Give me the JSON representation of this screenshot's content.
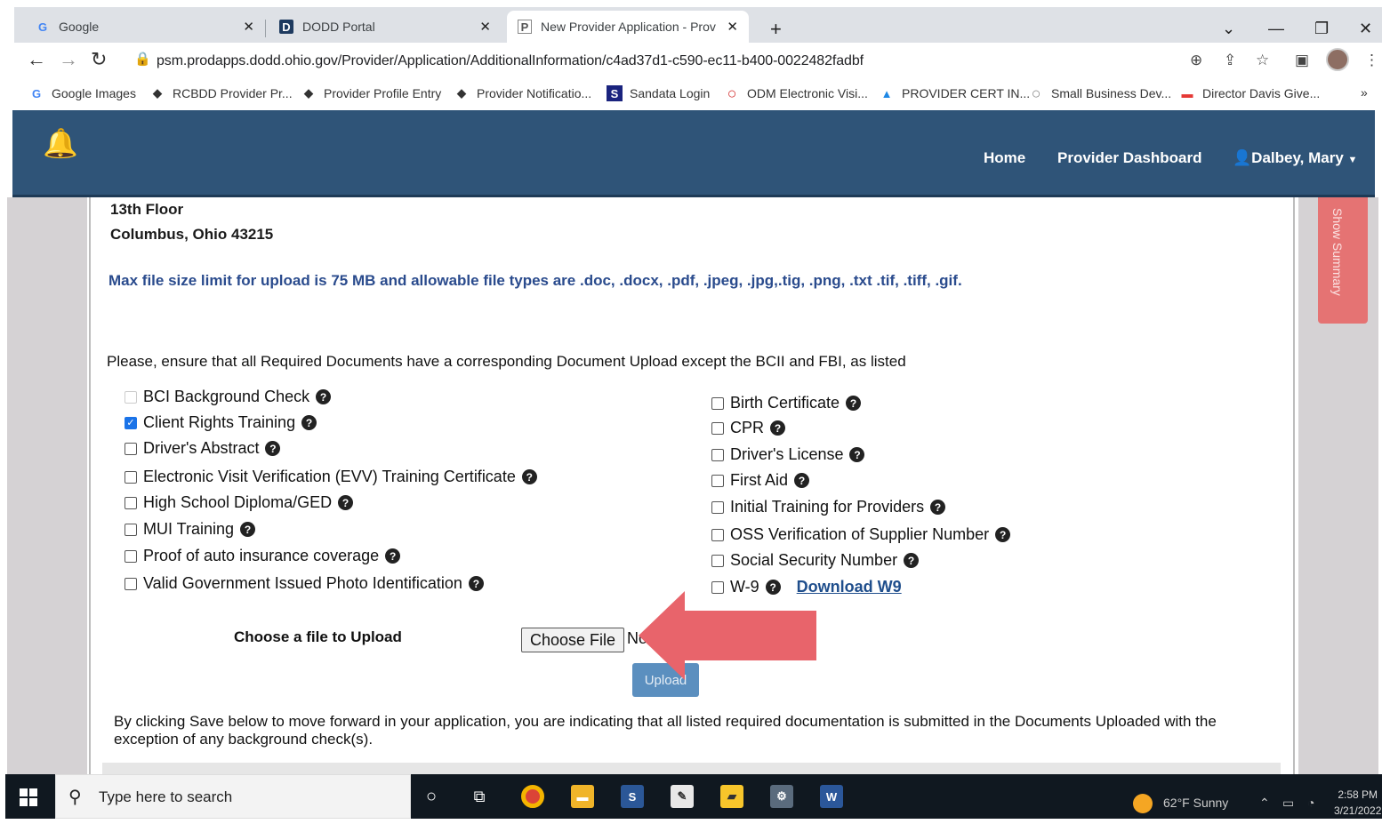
{
  "browser": {
    "tabs": [
      {
        "title": "Google",
        "icon": "G"
      },
      {
        "title": "DODD Portal",
        "icon": "D"
      },
      {
        "title": "New Provider Application - Prov",
        "icon": "P"
      }
    ],
    "new_tab": "+",
    "url": "psm.prodapps.dodd.ohio.gov/Provider/Application/AdditionalInformation/c4ad37d1-c590-ec11-b400-0022482fadbf",
    "bookmarks": [
      {
        "label": "Google Images",
        "icon": "G",
        "color": "#4285f4"
      },
      {
        "label": "RCBDD Provider Pr...",
        "icon": "◆",
        "color": "#222"
      },
      {
        "label": "Provider Profile Entry",
        "icon": "◆",
        "color": "#222"
      },
      {
        "label": "Provider Notificatio...",
        "icon": "◆",
        "color": "#222"
      },
      {
        "label": "Sandata Login",
        "icon": "S",
        "color": "#1a237e"
      },
      {
        "label": "ODM Electronic Visi...",
        "icon": "○",
        "color": "#d32f2f"
      },
      {
        "label": "PROVIDER CERT IN...",
        "icon": "▲",
        "color": "#1e88e5"
      },
      {
        "label": "Small Business Dev...",
        "icon": "○",
        "color": "#888"
      },
      {
        "label": "Director Davis Give...",
        "icon": "▬",
        "color": "#e53935"
      }
    ],
    "more_bookmarks": "»"
  },
  "site": {
    "nav": {
      "home": "Home",
      "dashboard": "Provider Dashboard",
      "user": "Dalbey, Mary"
    },
    "show_summary": "Show Summary",
    "address_line1": "13th Floor",
    "address_line2": "Columbus, Ohio 43215",
    "max_file_note": "Max file size limit for upload is 75 MB and allowable file types are .doc, .docx, .pdf, .jpeg, .jpg,.tig, .png, .txt .tif, .tiff, .gif.",
    "ensure_note": "Please, ensure that all Required Documents have a corresponding Document Upload except the BCII and FBI, as listed",
    "documents_left": [
      {
        "label": "BCI Background Check",
        "checked": false,
        "faded": true
      },
      {
        "label": "Client Rights Training",
        "checked": true
      },
      {
        "label": "Driver's Abstract",
        "checked": false
      },
      {
        "label": "Electronic Visit Verification (EVV) Training Certificate",
        "checked": false
      },
      {
        "label": "High School Diploma/GED",
        "checked": false
      },
      {
        "label": "MUI Training",
        "checked": false
      },
      {
        "label": "Proof of auto insurance coverage",
        "checked": false
      },
      {
        "label": "Valid Government Issued Photo Identification",
        "checked": false
      }
    ],
    "documents_right": [
      {
        "label": "Birth Certificate",
        "checked": false
      },
      {
        "label": "CPR",
        "checked": false
      },
      {
        "label": "Driver's License",
        "checked": false
      },
      {
        "label": "First Aid",
        "checked": false
      },
      {
        "label": "Initial Training for Providers",
        "checked": false
      },
      {
        "label": "OSS Verification of Supplier Number",
        "checked": false
      },
      {
        "label": "Social Security Number",
        "checked": false
      },
      {
        "label": "W-9",
        "checked": false
      }
    ],
    "download_w9": "Download W9",
    "choose_label": "Choose a file to Upload",
    "choose_file_button": "Choose File",
    "no_file_text": "No file chosen",
    "upload_button": "Upload",
    "footnote": "By clicking Save below to move forward in your application, you are indicating that all listed required documentation is submitted in the Documents Uploaded with the exception of any background check(s).",
    "arrow_color": "#e8646b"
  },
  "taskbar": {
    "search_placeholder": "Type here to search",
    "weather": "62°F  Sunny",
    "time": "2:58 PM",
    "date": "3/21/2022"
  }
}
